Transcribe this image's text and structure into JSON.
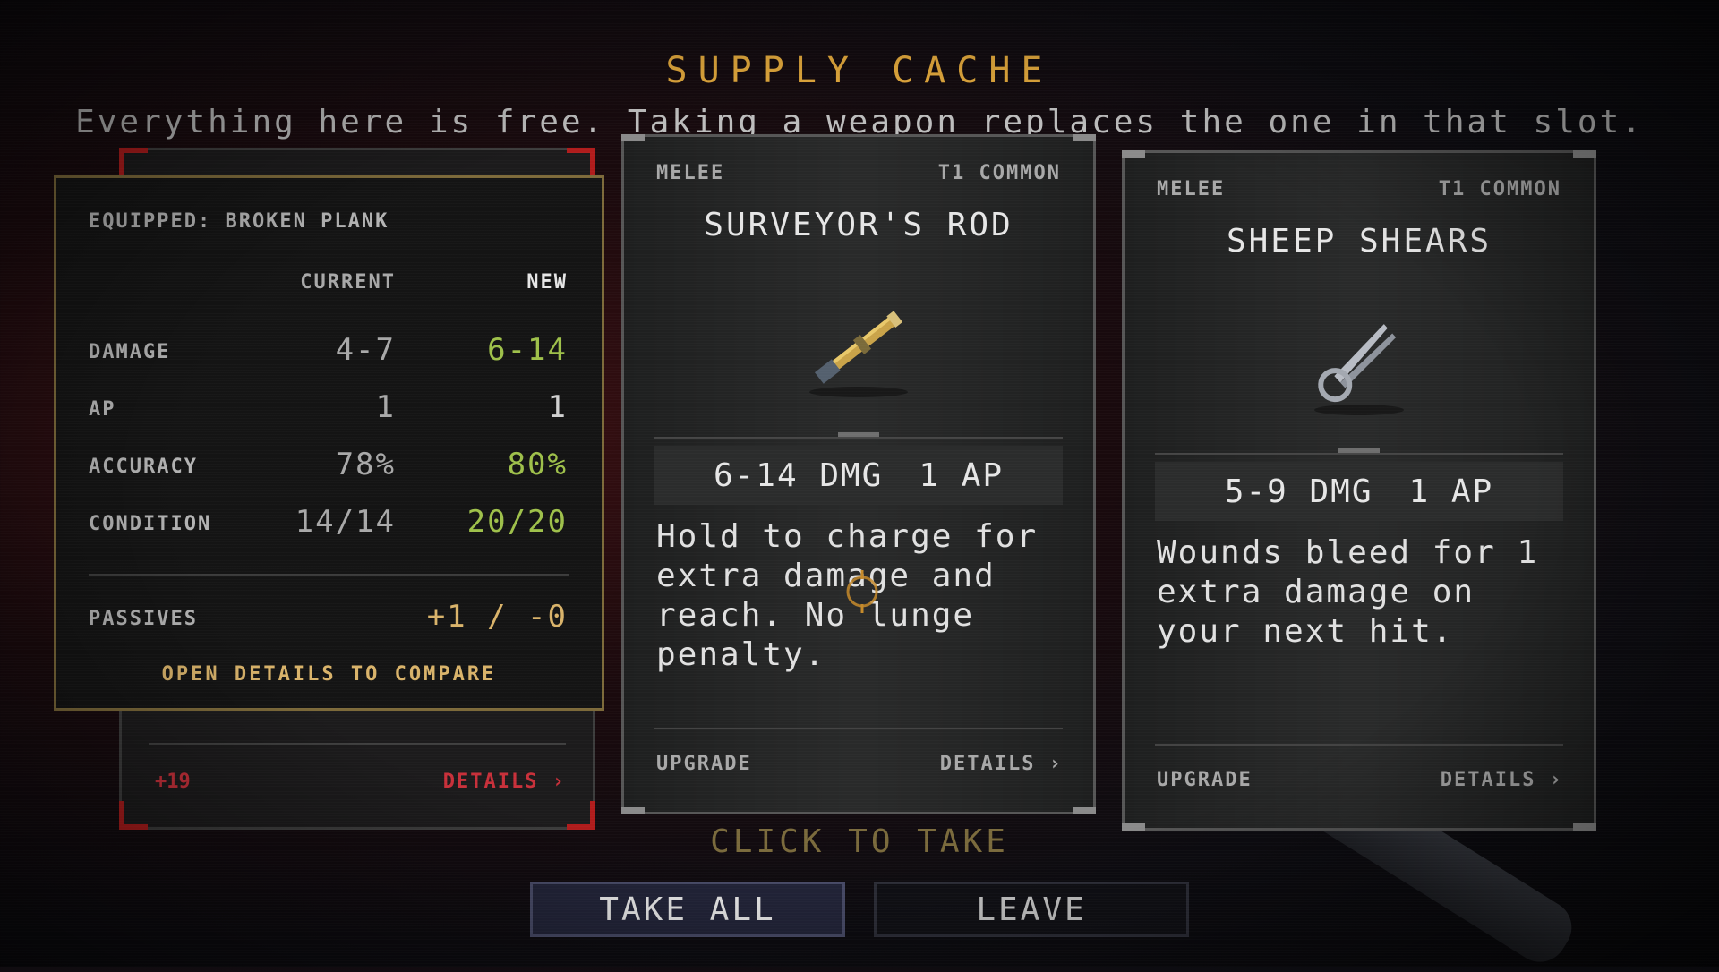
{
  "header": {
    "title": "SUPPLY CACHE",
    "subtitle": "Everything here is free. Taking a weapon replaces the one in that slot."
  },
  "back_card": {
    "bonus": "+19",
    "details_label": "DETAILS ›"
  },
  "compare": {
    "equipped": "EQUIPPED: BROKEN PLANK",
    "col_current": "CURRENT",
    "col_new": "NEW",
    "rows": [
      {
        "label": "DAMAGE",
        "current": "4-7",
        "new": "6-14"
      },
      {
        "label": "AP",
        "current": "1",
        "new": "1"
      },
      {
        "label": "ACCURACY",
        "current": "78%",
        "new": "80%"
      },
      {
        "label": "CONDITION",
        "current": "14/14",
        "new": "20/20"
      }
    ],
    "passives_label": "PASSIVES",
    "passives_value": "+1 / -0",
    "open_details": "OPEN DETAILS TO COMPARE"
  },
  "cards": [
    {
      "category": "MELEE",
      "tier": "T1 COMMON",
      "name": "SURVEYOR'S ROD",
      "icon": "rod-icon",
      "damage": "6-14 DMG",
      "ap": "1 AP",
      "description": "Hold to charge for extra damage and reach. No lunge penalty.",
      "upgrade_label": "UPGRADE",
      "details_label": "DETAILS ›"
    },
    {
      "category": "MELEE",
      "tier": "T1 COMMON",
      "name": "SHEEP SHEARS",
      "icon": "shears-icon",
      "damage": "5-9 DMG",
      "ap": "1 AP",
      "description": "Wounds bleed for 1 extra damage on your next hit.",
      "upgrade_label": "UPGRADE",
      "details_label": "DETAILS ›"
    }
  ],
  "click_to_take": "CLICK TO TAKE",
  "buttons": {
    "take_all": "TAKE ALL",
    "leave": "LEAVE"
  },
  "colors": {
    "title": "#e3a93c",
    "green": "#9ec04a",
    "gold_border": "#7d6a3a",
    "red_accent": "#c8303a"
  }
}
